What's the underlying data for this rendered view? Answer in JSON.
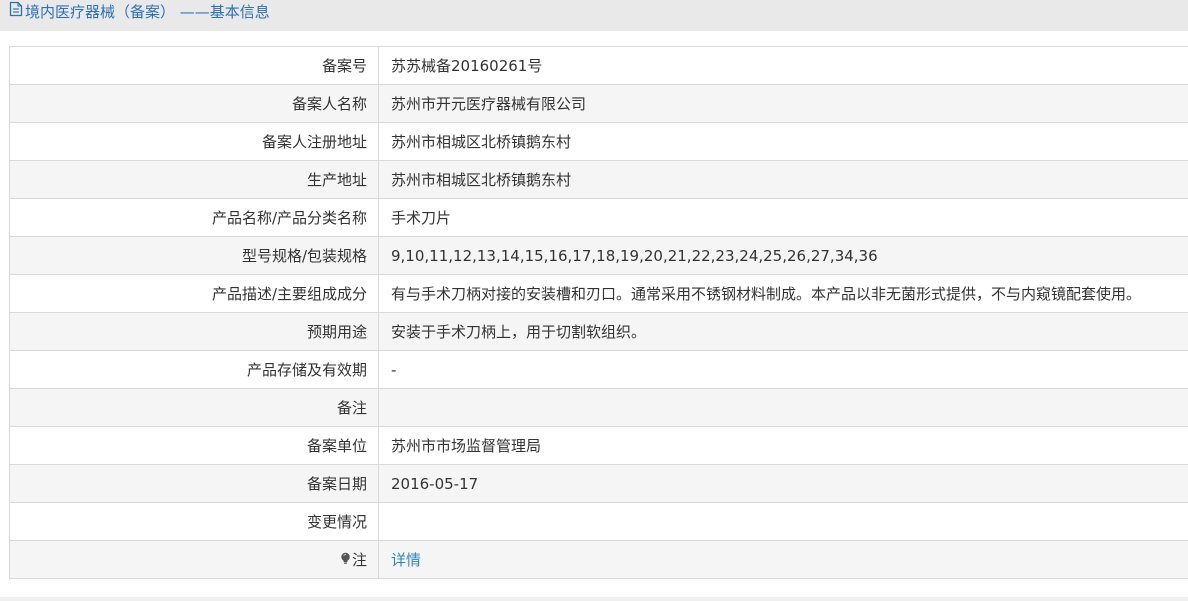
{
  "header": {
    "title": "境内医疗器械（备案） ——基本信息",
    "icon": "document-icon"
  },
  "rows": [
    {
      "label": "备案号",
      "value": "苏苏械备20160261号"
    },
    {
      "label": "备案人名称",
      "value": "苏州市开元医疗器械有限公司"
    },
    {
      "label": "备案人注册地址",
      "value": "苏州市相城区北桥镇鹅东村"
    },
    {
      "label": "生产地址",
      "value": "苏州市相城区北桥镇鹅东村"
    },
    {
      "label": "产品名称/产品分类名称",
      "value": "手术刀片"
    },
    {
      "label": "型号规格/包装规格",
      "value": "9,10,11,12,13,14,15,16,17,18,19,20,21,22,23,24,25,26,27,34,36"
    },
    {
      "label": "产品描述/主要组成成分",
      "value": "有与手术刀柄对接的安装槽和刃口。通常采用不锈钢材料制成。本产品以非无菌形式提供，不与内窥镜配套使用。"
    },
    {
      "label": "预期用途",
      "value": "安装于手术刀柄上，用于切割软组织。"
    },
    {
      "label": "产品存储及有效期",
      "value": "-"
    },
    {
      "label": "备注",
      "value": ""
    },
    {
      "label": "备案单位",
      "value": "苏州市市场监督管理局"
    },
    {
      "label": "备案日期",
      "value": "2016-05-17"
    },
    {
      "label": "变更情况",
      "value": ""
    }
  ],
  "note": {
    "label": "注",
    "icon": "lightbulb-icon",
    "link_text": "详情"
  },
  "colors": {
    "title": "#2e6fb8",
    "link": "#2e86c9",
    "border": "#d9d9d9",
    "alt_row": "#f5f5f5"
  }
}
